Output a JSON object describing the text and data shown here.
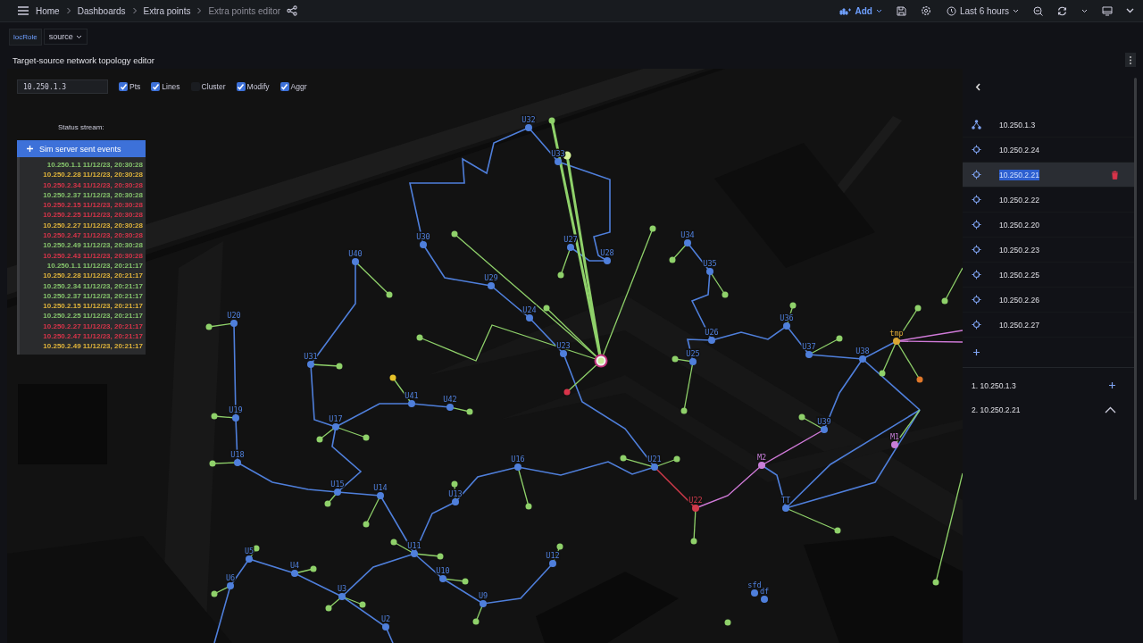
{
  "topbar": {
    "breadcrumbs": [
      {
        "label": "Home",
        "current": false
      },
      {
        "label": "Dashboards",
        "current": false
      },
      {
        "label": "Extra points",
        "current": false
      },
      {
        "label": "Extra points editor",
        "current": true
      }
    ],
    "add_label": "Add",
    "time_range": "Last 6 hours"
  },
  "variables": [
    {
      "name": "locRole",
      "value": "source"
    }
  ],
  "panel": {
    "title": "Target-source network topology editor",
    "controls": {
      "address": "10.250.1.3",
      "toggles": [
        {
          "label": "Pts",
          "checked": true
        },
        {
          "label": "Lines",
          "checked": true
        },
        {
          "label": "Cluster",
          "checked": false
        },
        {
          "label": "Modify",
          "checked": true
        },
        {
          "label": "Aggr",
          "checked": true
        }
      ],
      "status_label": "Status stream:",
      "events_button": "Sim server sent events",
      "events": [
        {
          "text": "10.250.1.1 11/12/23, 20:30:28",
          "color": "#86c46c"
        },
        {
          "text": "10.250.2.28 11/12/23, 20:30:28",
          "color": "#e0b43a"
        },
        {
          "text": "10.250.2.34 11/12/23, 20:30:28",
          "color": "#d8344a"
        },
        {
          "text": "10.250.2.37 11/12/23, 20:30:28",
          "color": "#86c46c"
        },
        {
          "text": "10.250.2.15 11/12/23, 20:30:28",
          "color": "#d8344a"
        },
        {
          "text": "10.250.2.25 11/12/23, 20:30:28",
          "color": "#d8344a"
        },
        {
          "text": "10.250.2.27 11/12/23, 20:30:28",
          "color": "#e0b43a"
        },
        {
          "text": "10.250.2.47 11/12/23, 20:30:28",
          "color": "#d8344a"
        },
        {
          "text": "10.250.2.49 11/12/23, 20:30:28",
          "color": "#86c46c"
        },
        {
          "text": "10.250.2.43 11/12/23, 20:30:28",
          "color": "#d8344a"
        },
        {
          "text": "10.250.1.1 11/12/23, 20:21:17",
          "color": "#86c46c"
        },
        {
          "text": "10.250.2.28 11/12/23, 20:21:17",
          "color": "#e0b43a"
        },
        {
          "text": "10.250.2.34 11/12/23, 20:21:17",
          "color": "#86c46c"
        },
        {
          "text": "10.250.2.37 11/12/23, 20:21:17",
          "color": "#86c46c"
        },
        {
          "text": "10.250.2.15 11/12/23, 20:21:17",
          "color": "#e0b43a"
        },
        {
          "text": "10.250.2.25 11/12/23, 20:21:17",
          "color": "#86c46c"
        },
        {
          "text": "10.250.2.27 11/12/23, 20:21:17",
          "color": "#d8344a"
        },
        {
          "text": "10.250.2.47 11/12/23, 20:21:17",
          "color": "#d8344a"
        },
        {
          "text": "10.250.2.49 11/12/23, 20:21:17",
          "color": "#e0b43a"
        }
      ]
    },
    "nodes": [
      {
        "label": "U32",
        "color": "#4f7fdb"
      },
      {
        "label": "U33",
        "color": "#4f7fdb"
      },
      {
        "label": "U30",
        "color": "#4f7fdb"
      },
      {
        "label": "U27",
        "color": "#4f7fdb"
      },
      {
        "label": "U28",
        "color": "#4f7fdb"
      },
      {
        "label": "U29",
        "color": "#4f7fdb"
      },
      {
        "label": "U24",
        "color": "#4f7fdb"
      },
      {
        "label": "U23",
        "color": "#4f7fdb"
      },
      {
        "label": "U34",
        "color": "#4f7fdb"
      },
      {
        "label": "U35",
        "color": "#4f7fdb"
      },
      {
        "label": "U36",
        "color": "#4f7fdb"
      },
      {
        "label": "U37",
        "color": "#4f7fdb"
      },
      {
        "label": "U38",
        "color": "#4f7fdb"
      },
      {
        "label": "U26",
        "color": "#4f7fdb"
      },
      {
        "label": "U25",
        "color": "#4f7fdb"
      },
      {
        "label": "U40",
        "color": "#4f7fdb"
      },
      {
        "label": "U20",
        "color": "#4f7fdb"
      },
      {
        "label": "U31",
        "color": "#4f7fdb"
      },
      {
        "label": "U41",
        "color": "#4f7fdb"
      },
      {
        "label": "U42",
        "color": "#4f7fdb"
      },
      {
        "label": "U17",
        "color": "#4f7fdb"
      },
      {
        "label": "U19",
        "color": "#4f7fdb"
      },
      {
        "label": "U18",
        "color": "#4f7fdb"
      },
      {
        "label": "U15",
        "color": "#4f7fdb"
      },
      {
        "label": "U14",
        "color": "#4f7fdb"
      },
      {
        "label": "U13",
        "color": "#4f7fdb"
      },
      {
        "label": "U16",
        "color": "#4f7fdb"
      },
      {
        "label": "U21",
        "color": "#4f7fdb"
      },
      {
        "label": "U22",
        "color": "#d23a4b"
      },
      {
        "label": "M2",
        "color": "#c77ed8"
      },
      {
        "label": "U39",
        "color": "#4f7fdb"
      },
      {
        "label": "M1",
        "color": "#c77ed8"
      },
      {
        "label": "TT",
        "color": "#4f7fdb"
      },
      {
        "label": "tmp",
        "color": "#d9a634"
      },
      {
        "label": "U11",
        "color": "#4f7fdb"
      },
      {
        "label": "U10",
        "color": "#4f7fdb"
      },
      {
        "label": "U12",
        "color": "#4f7fdb"
      },
      {
        "label": "U9",
        "color": "#4f7fdb"
      },
      {
        "label": "U5",
        "color": "#4f7fdb"
      },
      {
        "label": "U4",
        "color": "#4f7fdb"
      },
      {
        "label": "U6",
        "color": "#4f7fdb"
      },
      {
        "label": "U3",
        "color": "#4f7fdb"
      },
      {
        "label": "U2",
        "color": "#4f7fdb"
      },
      {
        "label": "sfd",
        "color": "#4f7fdb"
      },
      {
        "label": "df",
        "color": "#4f7fdb"
      }
    ],
    "endpoints": [
      {
        "color": "#8fd16a"
      },
      {
        "color": "#d6f29a"
      },
      {
        "color": "#8fd16a"
      },
      {
        "color": "#8fd16a"
      },
      {
        "color": "#8fd16a"
      },
      {
        "color": "#8fd16a"
      },
      {
        "color": "#d8344a"
      },
      {
        "color": "#8fd16a"
      },
      {
        "color": "#8fd16a"
      },
      {
        "color": "#8fd16a"
      },
      {
        "color": "#8fd16a"
      },
      {
        "color": "#8fd16a"
      },
      {
        "color": "#8fd16a"
      },
      {
        "color": "#8fd16a"
      },
      {
        "color": "#8fd16a"
      },
      {
        "color": "#8fd16a"
      },
      {
        "color": "#8fd16a"
      },
      {
        "color": "#e6c229"
      },
      {
        "color": "#8fd16a"
      },
      {
        "color": "#8fd16a"
      },
      {
        "color": "#8fd16a"
      },
      {
        "color": "#8fd16a"
      },
      {
        "color": "#8fd16a"
      },
      {
        "color": "#8fd16a"
      },
      {
        "color": "#8fd16a"
      },
      {
        "color": "#8fd16a"
      },
      {
        "color": "#8fd16a"
      },
      {
        "color": "#8fd16a"
      },
      {
        "color": "#8fd16a"
      },
      {
        "color": "#8fd16a"
      },
      {
        "color": "#8fd16a"
      },
      {
        "color": "#8fd16a"
      },
      {
        "color": "#8fd16a"
      },
      {
        "color": "#8fd16a"
      },
      {
        "color": "#8fd16a"
      },
      {
        "color": "#8fd16a"
      },
      {
        "color": "#8fd16a"
      },
      {
        "color": "#8fd16a"
      },
      {
        "color": "#8fd16a"
      },
      {
        "color": "#8fd16a"
      },
      {
        "color": "#8fd16a"
      },
      {
        "color": "#8fd16a"
      },
      {
        "color": "#8fd16a"
      },
      {
        "color": "#8fd16a"
      },
      {
        "color": "#8fd16a"
      },
      {
        "color": "#8fd16a"
      },
      {
        "color": "#8fd16a"
      },
      {
        "color": "#e0782a"
      }
    ]
  },
  "sidebar": {
    "items": [
      {
        "label": "10.250.1.3",
        "kind": "group",
        "selected": false
      },
      {
        "label": "10.250.2.24",
        "kind": "target",
        "selected": false
      },
      {
        "label": "10.250.2.21",
        "kind": "target",
        "selected": true
      },
      {
        "label": "10.250.2.22",
        "kind": "target",
        "selected": false
      },
      {
        "label": "10.250.2.20",
        "kind": "target",
        "selected": false
      },
      {
        "label": "10.250.2.23",
        "kind": "target",
        "selected": false
      },
      {
        "label": "10.250.2.25",
        "kind": "target",
        "selected": false
      },
      {
        "label": "10.250.2.26",
        "kind": "target",
        "selected": false
      },
      {
        "label": "10.250.2.27",
        "kind": "target",
        "selected": false
      }
    ],
    "path": [
      {
        "label": "1. 10.250.1.3",
        "kind": "add"
      },
      {
        "label": "2. 10.250.2.21",
        "kind": "up"
      }
    ]
  }
}
